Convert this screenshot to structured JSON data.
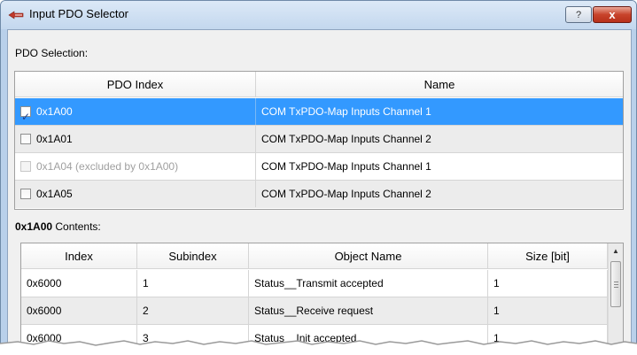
{
  "window": {
    "title": "Input PDO Selector",
    "help_label": "?",
    "close_label": "x"
  },
  "pdo_selection": {
    "label": "PDO Selection:",
    "columns": [
      "PDO Index",
      "Name"
    ],
    "rows": [
      {
        "index": "0x1A00",
        "name": "COM TxPDO-Map Inputs Channel 1",
        "checked": true,
        "selected": true,
        "disabled": false
      },
      {
        "index": "0x1A01",
        "name": "COM TxPDO-Map Inputs Channel 2",
        "checked": false,
        "selected": false,
        "disabled": false
      },
      {
        "index": "0x1A04 (excluded by 0x1A00)",
        "name": "COM TxPDO-Map Inputs Channel 1",
        "checked": false,
        "selected": false,
        "disabled": true
      },
      {
        "index": "0x1A05",
        "name": "COM TxPDO-Map Inputs Channel 2",
        "checked": false,
        "selected": false,
        "disabled": false
      }
    ]
  },
  "contents": {
    "label_bold": "0x1A00",
    "label_rest": " Contents:",
    "columns": [
      "Index",
      "Subindex",
      "Object Name",
      "Size [bit]"
    ],
    "rows": [
      {
        "index": "0x6000",
        "subindex": "1",
        "object_name": "Status__Transmit accepted",
        "size": "1"
      },
      {
        "index": "0x6000",
        "subindex": "2",
        "object_name": "Status__Receive request",
        "size": "1"
      },
      {
        "index": "0x6000",
        "subindex": "3",
        "object_name": "Status__Init accepted",
        "size": "1"
      }
    ]
  },
  "colors": {
    "selection": "#3399ff",
    "alt_row": "#ececec",
    "close_button": "#c8432b"
  }
}
